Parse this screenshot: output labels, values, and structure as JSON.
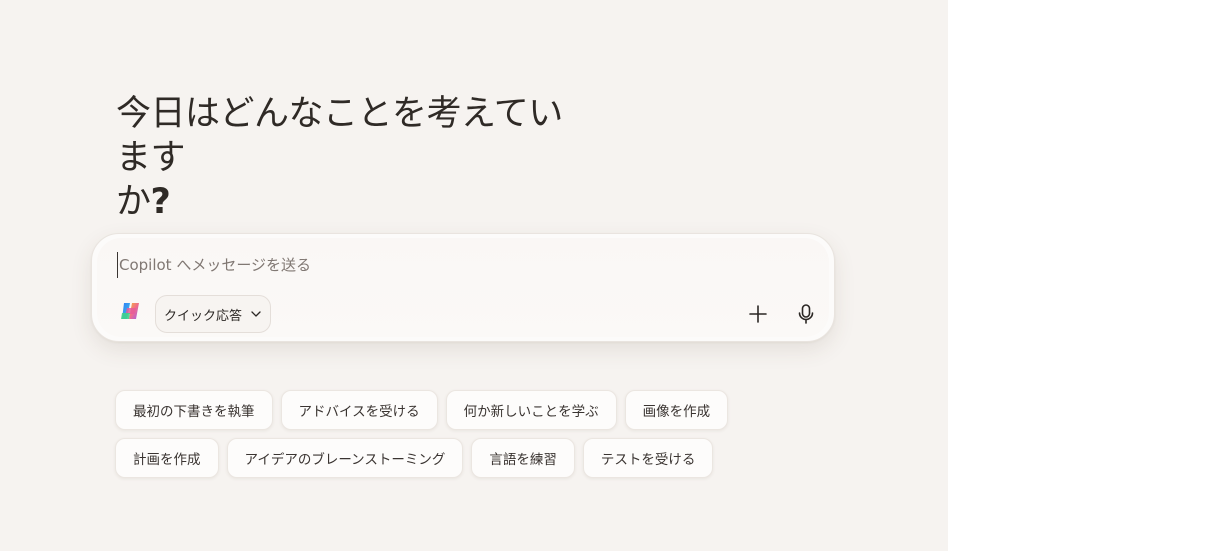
{
  "greeting": {
    "line1": "今日はどんなことを考えています",
    "line2_text": "か",
    "line2_mark": "?"
  },
  "composer": {
    "placeholder": "Copilot へメッセージを送る",
    "mode_label": "クイック応答",
    "icons": {
      "logo": "copilot-logo",
      "mode": "chevron-down-icon",
      "add": "plus-icon",
      "voice": "microphone-icon"
    }
  },
  "suggestions": {
    "row1": [
      "最初の下書きを執筆",
      "アドバイスを受ける",
      "何か新しいことを学ぶ",
      "画像を作成"
    ],
    "row2": [
      "計画を作成",
      "アイデアのブレーンストーミング",
      "言語を練習",
      "テストを受ける"
    ]
  },
  "colors": {
    "background": "#f6f3f0",
    "composer": "#fcfbfa",
    "chip": "#fdfcfb",
    "text": "#2b2724"
  }
}
